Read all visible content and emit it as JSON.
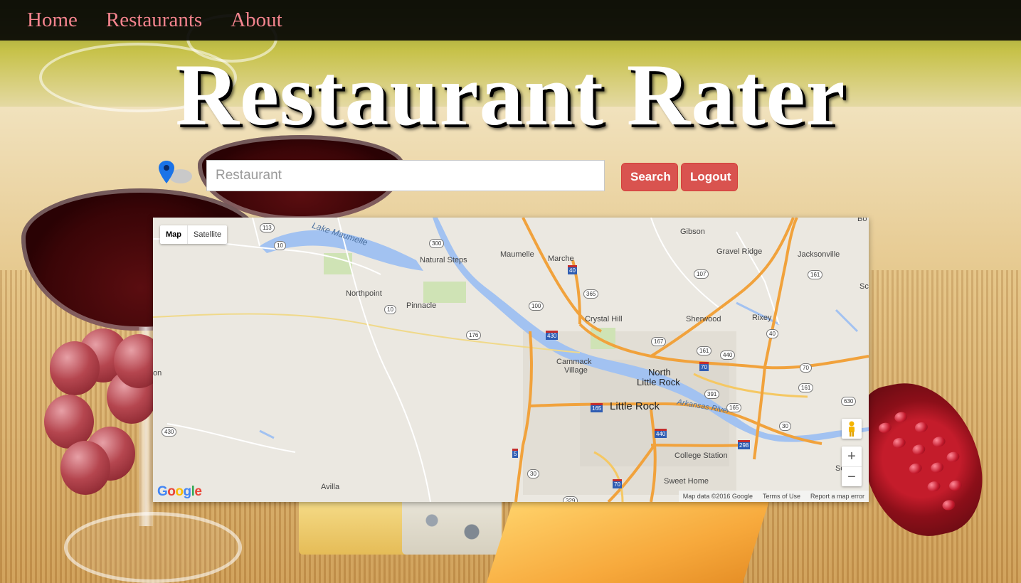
{
  "nav": {
    "items": [
      {
        "label": "Home"
      },
      {
        "label": "Restaurants"
      },
      {
        "label": "About"
      }
    ],
    "link_color": "#f3838d"
  },
  "header": {
    "title": "Restaurant Rater"
  },
  "search": {
    "placeholder": "Restaurant",
    "value": "",
    "search_button": "Search",
    "logout_button": "Logout",
    "button_color": "#d9534f"
  },
  "map": {
    "type_control": {
      "map": "Map",
      "satellite": "Satellite",
      "selected": "Map"
    },
    "zoom_in": "+",
    "zoom_out": "−",
    "logo": {
      "g": "G",
      "o1": "o",
      "o2": "o",
      "g2": "g",
      "l": "l",
      "e": "e"
    },
    "attribution": {
      "data": "Map data ©2016 Google",
      "terms": "Terms of Use",
      "report": "Report a map error"
    },
    "places": [
      {
        "name": "Lake Maumelle"
      },
      {
        "name": "Natural Steps"
      },
      {
        "name": "Maumelle"
      },
      {
        "name": "Marche"
      },
      {
        "name": "Gibson"
      },
      {
        "name": "Gravel Ridge"
      },
      {
        "name": "Jacksonville"
      },
      {
        "name": "Northpoint"
      },
      {
        "name": "Pinnacle"
      },
      {
        "name": "Crystal Hill"
      },
      {
        "name": "Sherwood"
      },
      {
        "name": "Rixey"
      },
      {
        "name": "Cammack"
      },
      {
        "name": "Village"
      },
      {
        "name": "North"
      },
      {
        "name": "Little Rock"
      },
      {
        "name": "Little Rock"
      },
      {
        "name": "Arkansas River"
      },
      {
        "name": "College Station"
      },
      {
        "name": "Sweet Home"
      },
      {
        "name": "Avilla"
      },
      {
        "name": "Bo"
      },
      {
        "name": "Sc"
      },
      {
        "name": "Sco"
      },
      {
        "name": "on"
      }
    ],
    "routes": [
      "113",
      "10",
      "300",
      "40",
      "107",
      "161",
      "365",
      "100",
      "10",
      "430",
      "176",
      "167",
      "161",
      "440",
      "40",
      "70",
      "70",
      "391",
      "161",
      "630",
      "165",
      "165",
      "30",
      "440",
      "298",
      "430",
      "5",
      "30",
      "70",
      "329"
    ]
  }
}
